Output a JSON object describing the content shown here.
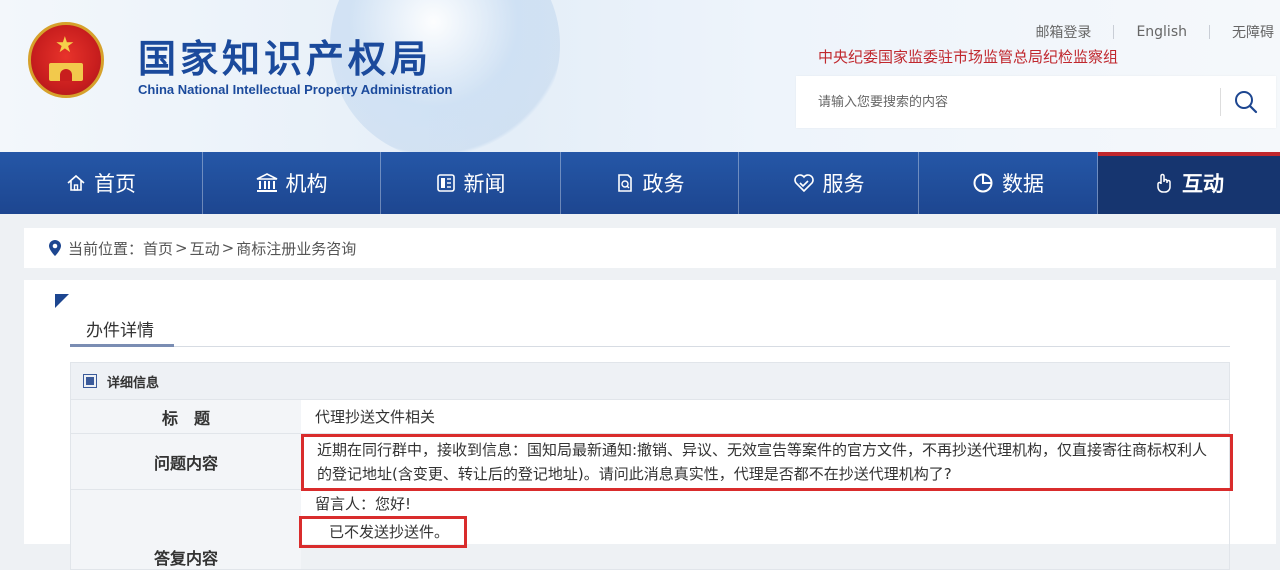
{
  "header": {
    "logo_cn": "国家知识产权局",
    "logo_en": "China National Intellectual Property Administration",
    "links": [
      "邮箱登录",
      "English",
      "无障碍"
    ],
    "supervision": "中央纪委国家监委驻市场监管总局纪检监察组",
    "search_placeholder": "请输入您要搜索的内容"
  },
  "nav": [
    {
      "label": "首页",
      "icon": "home-icon"
    },
    {
      "label": "机构",
      "icon": "institution-icon"
    },
    {
      "label": "新闻",
      "icon": "news-icon"
    },
    {
      "label": "政务",
      "icon": "government-affairs-icon"
    },
    {
      "label": "服务",
      "icon": "service-icon"
    },
    {
      "label": "数据",
      "icon": "data-pie-icon"
    },
    {
      "label": "互动",
      "icon": "interaction-hand-icon",
      "active": true
    }
  ],
  "breadcrumb": {
    "prefix": "当前位置：",
    "items": [
      "首页",
      "互动",
      "商标注册业务咨询"
    ],
    "separator": ">"
  },
  "detail": {
    "tab_label": "办件详情",
    "section_title": "详细信息",
    "rows": [
      {
        "label": "标　题",
        "value": "代理抄送文件相关"
      },
      {
        "label": "问题内容",
        "value": "近期在同行群中，接收到信息：国知局最新通知:撤销、异议、无效宣告等案件的官方文件，不再抄送代理机构，仅直接寄往商标权利人的登记地址(含变更、转让后的登记地址)。请问此消息真实性，代理是否都不在抄送代理机构了?"
      },
      {
        "label": "答复内容",
        "value_lines": [
          "留言人：您好!",
          "已不发送抄送件。"
        ]
      }
    ]
  },
  "colors": {
    "nav_bg": "#1d4690",
    "nav_active": "#16356f",
    "brand_blue": "#1b4a9c",
    "accent_red": "#c0272d",
    "highlight_red": "#d92c2c"
  }
}
